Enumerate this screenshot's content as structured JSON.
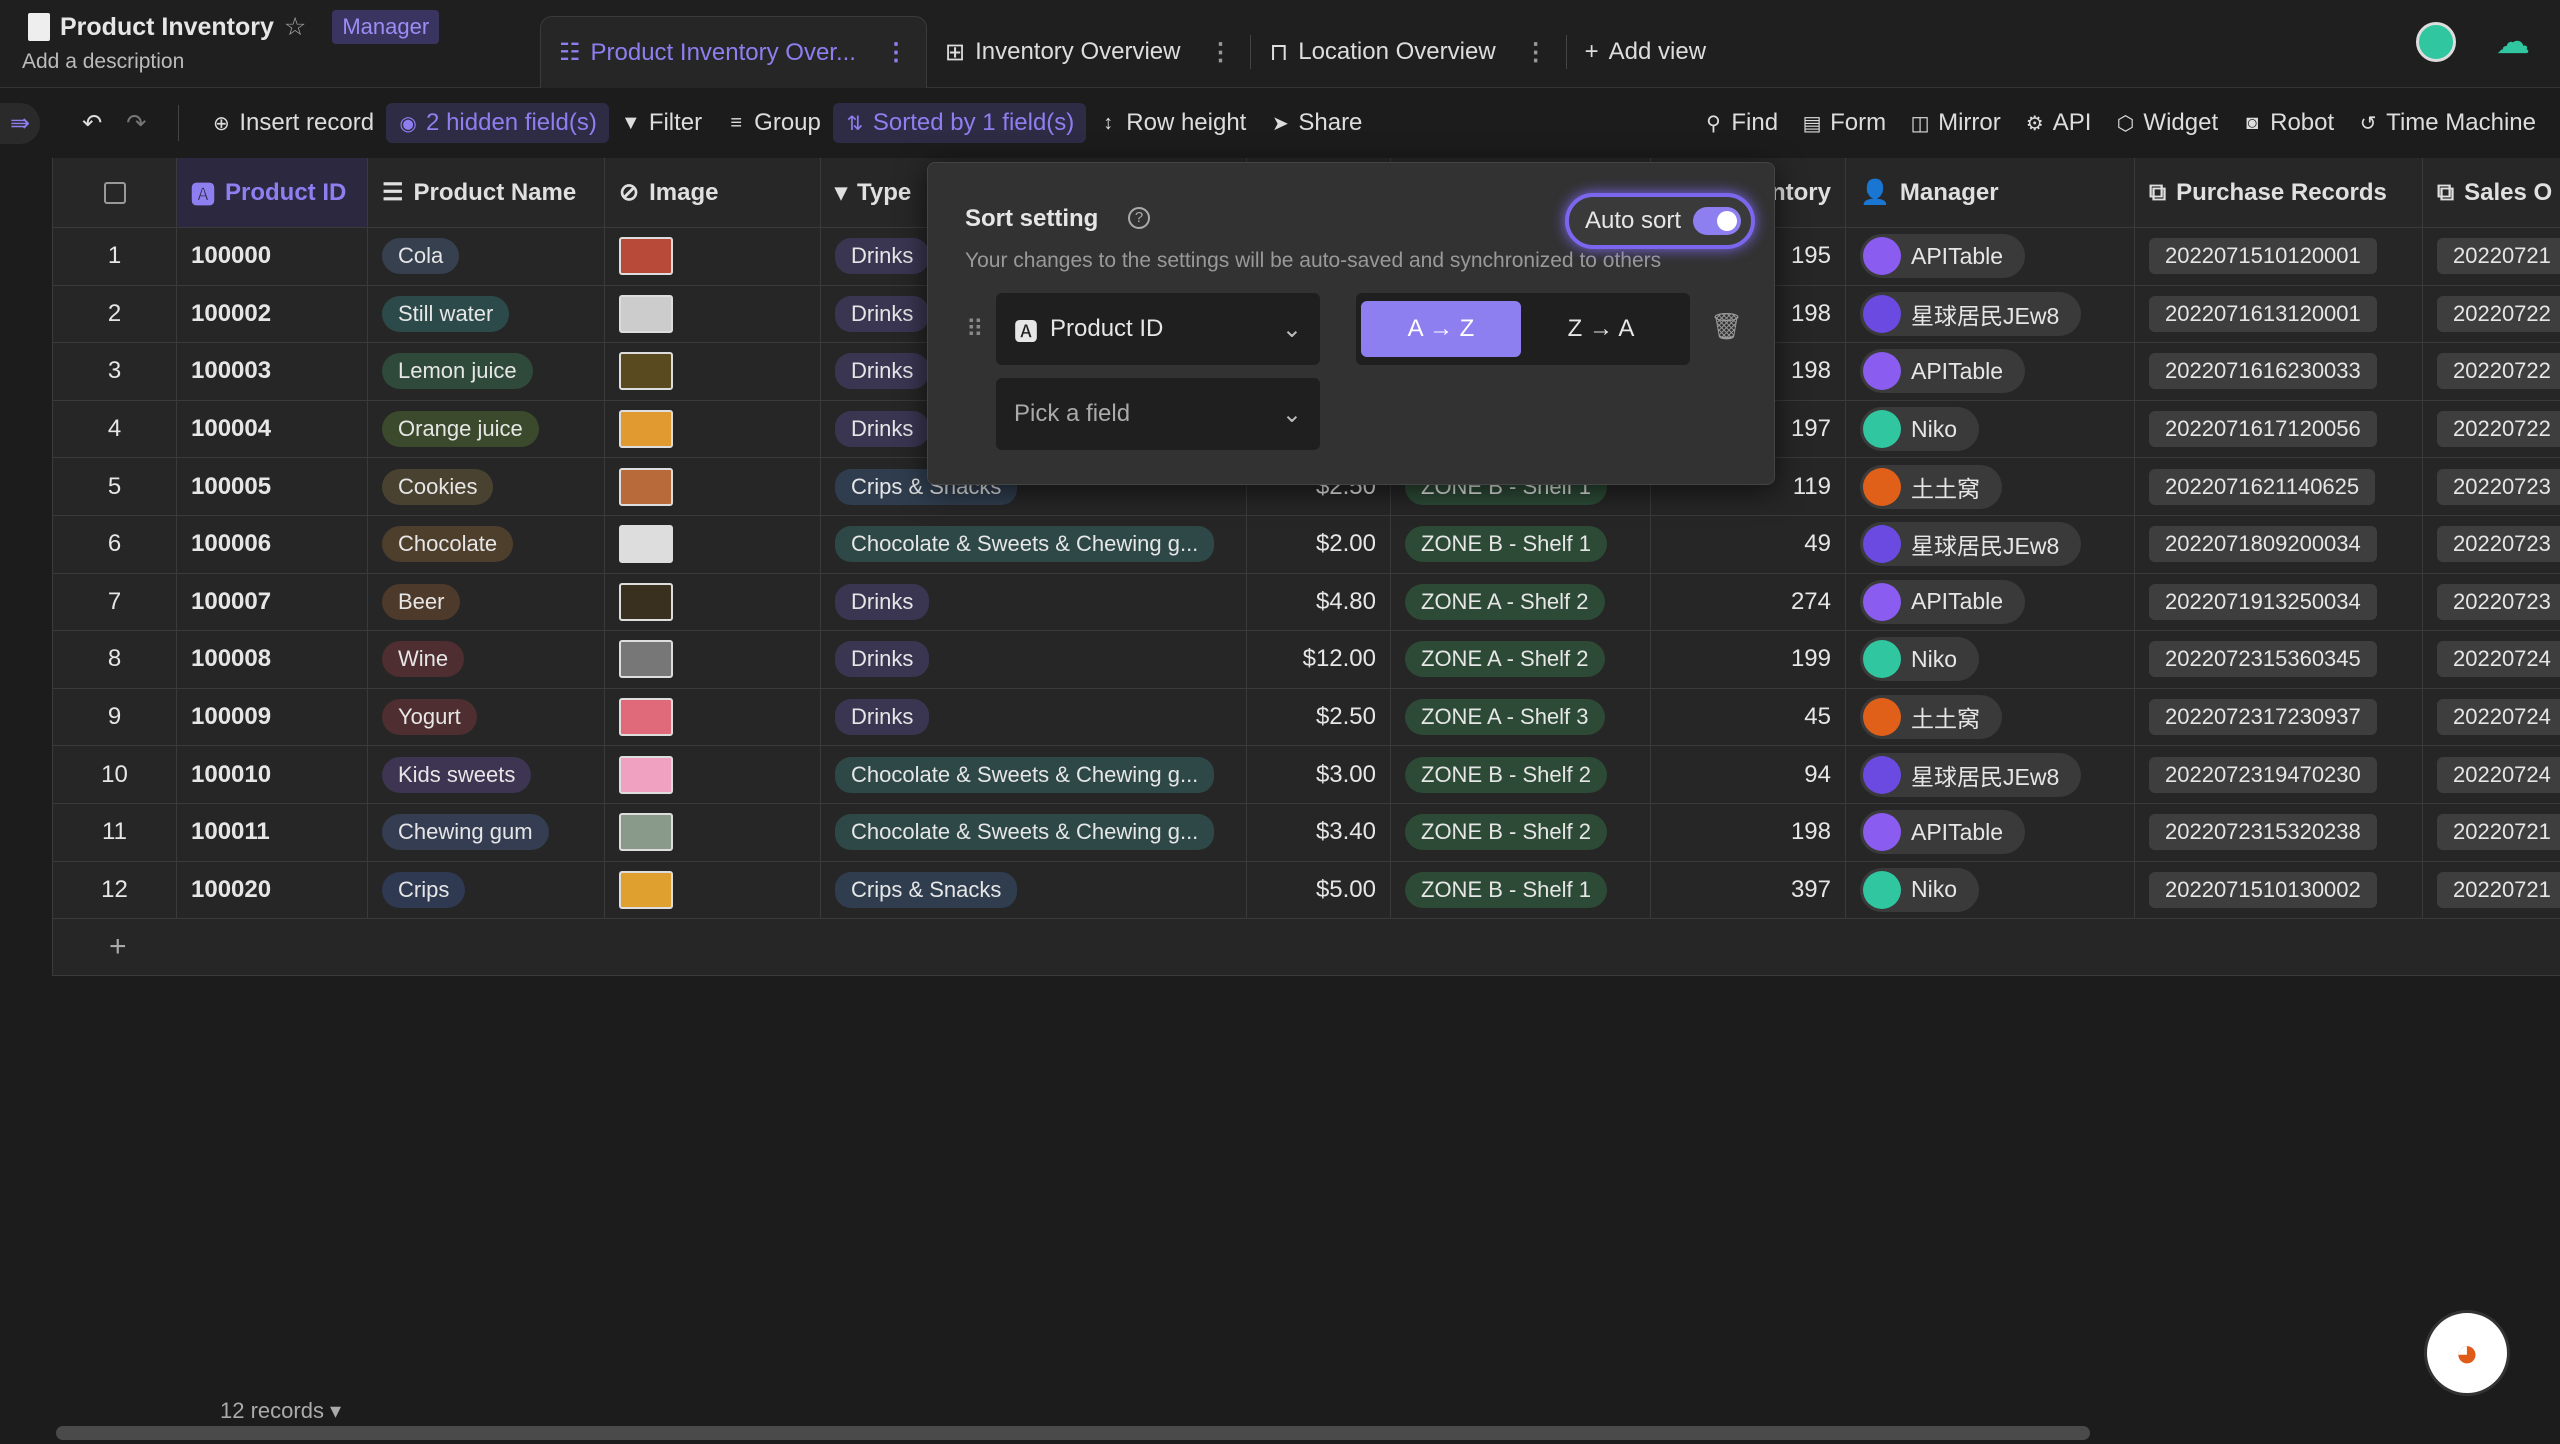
{
  "header": {
    "title": "Product Inventory",
    "role_badge": "Manager",
    "description": "Add a description"
  },
  "tabs": [
    {
      "label": "Product Inventory Over...",
      "active": true
    },
    {
      "label": "Inventory Overview"
    },
    {
      "label": "Location Overview"
    }
  ],
  "add_view": "Add view",
  "toolbar": {
    "insert": "Insert record",
    "hidden": "2 hidden field(s)",
    "filter": "Filter",
    "group": "Group",
    "sorted": "Sorted by 1 field(s)",
    "row_height": "Row height",
    "share": "Share",
    "find": "Find",
    "form": "Form",
    "mirror": "Mirror",
    "api": "API",
    "widget": "Widget",
    "robot": "Robot",
    "time_machine": "Time Machine"
  },
  "columns": [
    "Product ID",
    "Product Name",
    "Image",
    "Type",
    "",
    "",
    "Inventory",
    "Manager",
    "Purchase Records",
    "Sales O"
  ],
  "colors": {
    "accent": "#8d7ff0",
    "background": "#1c1c1c"
  },
  "rows": [
    {
      "n": "1",
      "id": "100000",
      "name": "Cola",
      "type": "Drinks",
      "price": "",
      "loc": "",
      "inv": "195",
      "mgr": "APITable",
      "pr": "2022071510120001",
      "so": "20220721"
    },
    {
      "n": "2",
      "id": "100002",
      "name": "Still water",
      "type": "Drinks",
      "price": "",
      "loc": "",
      "inv": "198",
      "mgr": "星球居民JEw8",
      "pr": "2022071613120001",
      "so": "20220722"
    },
    {
      "n": "3",
      "id": "100003",
      "name": "Lemon juice",
      "type": "Drinks",
      "price": "",
      "loc": "",
      "inv": "198",
      "mgr": "APITable",
      "pr": "2022071616230033",
      "so": "20220722"
    },
    {
      "n": "4",
      "id": "100004",
      "name": "Orange juice",
      "type": "Drinks",
      "price": "",
      "loc": "",
      "inv": "197",
      "mgr": "Niko",
      "pr": "2022071617120056",
      "so": "20220722"
    },
    {
      "n": "5",
      "id": "100005",
      "name": "Cookies",
      "type": "Crips & Snacks",
      "price": "$2.50",
      "loc": "ZONE B - Shelf 1",
      "inv": "119",
      "mgr": "土土窝",
      "pr": "2022071621140625",
      "so": "20220723"
    },
    {
      "n": "6",
      "id": "100006",
      "name": "Chocolate",
      "type": "Chocolate & Sweets & Chewing g...",
      "price": "$2.00",
      "loc": "ZONE B - Shelf 1",
      "inv": "49",
      "mgr": "星球居民JEw8",
      "pr": "2022071809200034",
      "so": "20220723"
    },
    {
      "n": "7",
      "id": "100007",
      "name": "Beer",
      "type": "Drinks",
      "price": "$4.80",
      "loc": "ZONE A - Shelf 2",
      "inv": "274",
      "mgr": "APITable",
      "pr": "2022071913250034",
      "so": "20220723"
    },
    {
      "n": "8",
      "id": "100008",
      "name": "Wine",
      "type": "Drinks",
      "price": "$12.00",
      "loc": "ZONE A - Shelf 2",
      "inv": "199",
      "mgr": "Niko",
      "pr": "2022072315360345",
      "so": "20220724"
    },
    {
      "n": "9",
      "id": "100009",
      "name": "Yogurt",
      "type": "Drinks",
      "price": "$2.50",
      "loc": "ZONE A - Shelf 3",
      "inv": "45",
      "mgr": "土土窝",
      "pr": "2022072317230937",
      "so": "20220724"
    },
    {
      "n": "10",
      "id": "100010",
      "name": "Kids sweets",
      "type": "Chocolate & Sweets & Chewing g...",
      "price": "$3.00",
      "loc": "ZONE B - Shelf 2",
      "inv": "94",
      "mgr": "星球居民JEw8",
      "pr": "2022072319470230",
      "so": "20220724"
    },
    {
      "n": "11",
      "id": "100011",
      "name": "Chewing gum",
      "type": "Chocolate & Sweets & Chewing g...",
      "price": "$3.40",
      "loc": "ZONE B - Shelf 2",
      "inv": "198",
      "mgr": "APITable",
      "pr": "2022072315320238",
      "so": "20220721"
    },
    {
      "n": "12",
      "id": "100020",
      "name": "Crips",
      "type": "Crips & Snacks",
      "price": "$5.00",
      "loc": "ZONE B - Shelf 1",
      "inv": "397",
      "mgr": "Niko",
      "pr": "2022071510130002",
      "so": "20220721"
    }
  ],
  "sort_popup": {
    "title": "Sort setting",
    "note": "Your changes to the settings will be auto-saved and synchronized to others",
    "auto_sort_label": "Auto sort",
    "auto_sort_on": true,
    "field": "Product ID",
    "placeholder": "Pick a field",
    "asc": "A → Z",
    "desc": "Z → A",
    "selected_order": "asc"
  },
  "footer": {
    "records": "12 records ▾"
  }
}
